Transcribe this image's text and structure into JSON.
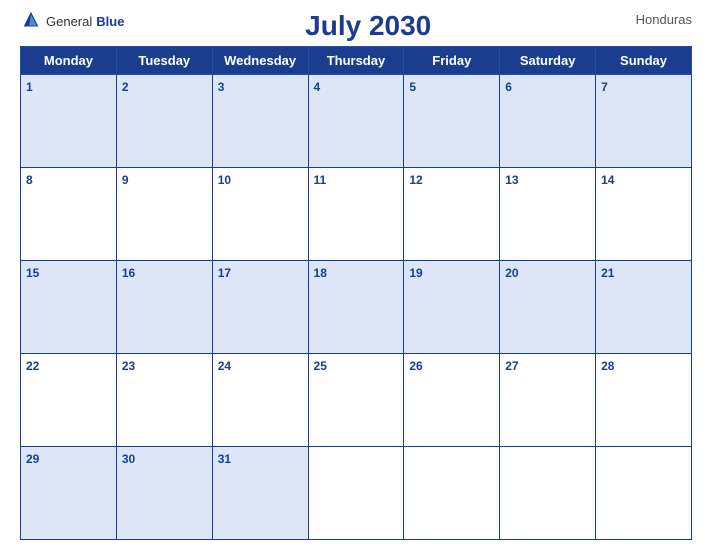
{
  "header": {
    "title": "July 2030",
    "country": "Honduras",
    "logo_general": "General",
    "logo_blue": "Blue"
  },
  "weekdays": [
    "Monday",
    "Tuesday",
    "Wednesday",
    "Thursday",
    "Friday",
    "Saturday",
    "Sunday"
  ],
  "weeks": [
    [
      {
        "day": 1,
        "empty": false
      },
      {
        "day": 2,
        "empty": false
      },
      {
        "day": 3,
        "empty": false
      },
      {
        "day": 4,
        "empty": false
      },
      {
        "day": 5,
        "empty": false
      },
      {
        "day": 6,
        "empty": false
      },
      {
        "day": 7,
        "empty": false
      }
    ],
    [
      {
        "day": 8,
        "empty": false
      },
      {
        "day": 9,
        "empty": false
      },
      {
        "day": 10,
        "empty": false
      },
      {
        "day": 11,
        "empty": false
      },
      {
        "day": 12,
        "empty": false
      },
      {
        "day": 13,
        "empty": false
      },
      {
        "day": 14,
        "empty": false
      }
    ],
    [
      {
        "day": 15,
        "empty": false
      },
      {
        "day": 16,
        "empty": false
      },
      {
        "day": 17,
        "empty": false
      },
      {
        "day": 18,
        "empty": false
      },
      {
        "day": 19,
        "empty": false
      },
      {
        "day": 20,
        "empty": false
      },
      {
        "day": 21,
        "empty": false
      }
    ],
    [
      {
        "day": 22,
        "empty": false
      },
      {
        "day": 23,
        "empty": false
      },
      {
        "day": 24,
        "empty": false
      },
      {
        "day": 25,
        "empty": false
      },
      {
        "day": 26,
        "empty": false
      },
      {
        "day": 27,
        "empty": false
      },
      {
        "day": 28,
        "empty": false
      }
    ],
    [
      {
        "day": 29,
        "empty": false
      },
      {
        "day": 30,
        "empty": false
      },
      {
        "day": 31,
        "empty": false
      },
      {
        "day": null,
        "empty": true
      },
      {
        "day": null,
        "empty": true
      },
      {
        "day": null,
        "empty": true
      },
      {
        "day": null,
        "empty": true
      }
    ]
  ]
}
